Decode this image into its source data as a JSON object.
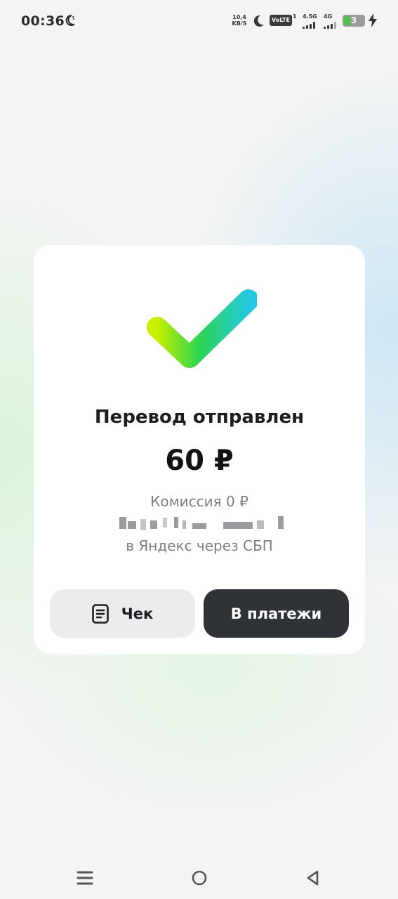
{
  "status_bar": {
    "time": "00:36",
    "net_speed_value": "10,4",
    "net_speed_unit": "KB/S",
    "volte_label": "VoLTE",
    "volte_sup": "1",
    "sim1_label": "4.5G",
    "sim2_label": "4G",
    "battery_level": "3",
    "icons": [
      "moon-icon",
      "dnd-moon-icon",
      "signal-icon",
      "battery-icon",
      "charging-bolt-icon"
    ]
  },
  "transfer": {
    "title": "Перевод отправлен",
    "amount": "60 ₽",
    "commission": "Комиссия 0 ₽",
    "destination": "в Яндекс через СБП",
    "success_color": "#1ec86a"
  },
  "actions": {
    "receipt_label": "Чек",
    "payments_label": "В платежи"
  },
  "nav": {
    "icons": [
      "menu-icon",
      "home-icon",
      "back-icon"
    ]
  }
}
